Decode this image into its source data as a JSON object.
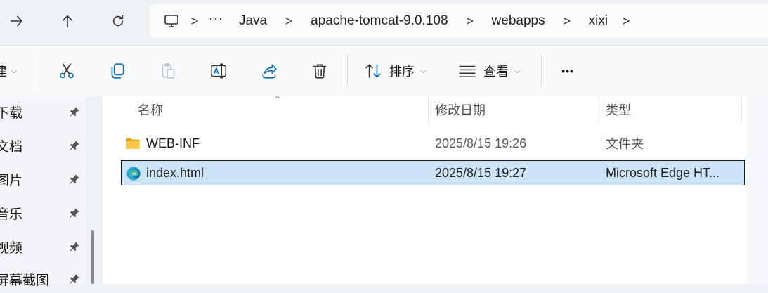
{
  "nav": {
    "back_icon": "forward-arrow-icon",
    "up_icon": "up-arrow-icon",
    "refresh_icon": "refresh-icon"
  },
  "address": {
    "root_icon": "this-pc-icon",
    "overflow": "···",
    "separator": ">",
    "crumbs": [
      "Java",
      "apache-tomcat-9.0.108",
      "webapps",
      "xixi"
    ]
  },
  "toolbar": {
    "new_label_partial": "建",
    "sort_label": "排序",
    "view_label": "查看",
    "more_label": "•••",
    "icons": [
      "cut-icon",
      "copy-icon",
      "paste-icon",
      "rename-icon",
      "share-icon",
      "delete-icon",
      "sort-icon",
      "view-icon",
      "more-icon"
    ]
  },
  "sidebar": {
    "items": [
      {
        "label": "下载"
      },
      {
        "label": "文档"
      },
      {
        "label": "图片"
      },
      {
        "label": "音乐"
      },
      {
        "label": "视频"
      },
      {
        "label": "屏幕截图"
      }
    ]
  },
  "columns": {
    "name": "名称",
    "modified": "修改日期",
    "type": "类型",
    "sort_indicator": "^"
  },
  "files": [
    {
      "name": "WEB-INF",
      "modified": "2025/8/15 19:26",
      "type": "文件夹",
      "icon": "folder-icon",
      "selected": false
    },
    {
      "name": "index.html",
      "modified": "2025/8/15 19:27",
      "type": "Microsoft Edge HT...",
      "icon": "edge-icon",
      "selected": true
    }
  ],
  "colors": {
    "selection": "#cce4f7",
    "folder": "#f7c948",
    "accent": "#0f6cbd"
  }
}
